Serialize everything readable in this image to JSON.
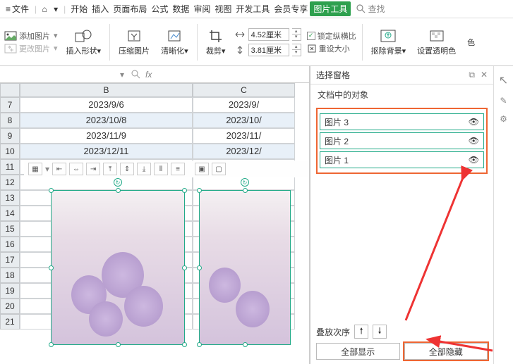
{
  "topbar": {
    "file_label": "文件",
    "search_label": "查找",
    "tabs": [
      "开始",
      "插入",
      "页面布局",
      "公式",
      "数据",
      "审阅",
      "视图",
      "开发工具",
      "会员专享",
      "图片工具"
    ]
  },
  "ribbon": {
    "add_image": "添加图片",
    "change_image": "更改图片",
    "insert_shape": "插入形状",
    "compress": "压缩图片",
    "sharpen": "清晰化",
    "crop": "裁剪",
    "width_val": "4.52厘米",
    "height_val": "3.81厘米",
    "lock_ratio": "锁定纵横比",
    "reset_size": "重设大小",
    "remove_bg": "抠除背景",
    "transparent": "设置透明色",
    "color_short": "色"
  },
  "formula_bar": {
    "fx": "fx"
  },
  "sheet": {
    "cols": [
      "B",
      "C"
    ],
    "rows": [
      {
        "n": 7,
        "b": "2023/9/6",
        "c": "2023/9/"
      },
      {
        "n": 8,
        "b": "2023/10/8",
        "c": "2023/10/"
      },
      {
        "n": 9,
        "b": "2023/11/9",
        "c": "2023/11/"
      },
      {
        "n": 10,
        "b": "2023/12/11",
        "c": "2023/12/"
      },
      {
        "n": 11,
        "b": "",
        "c": ""
      },
      {
        "n": 12,
        "b": "",
        "c": ""
      },
      {
        "n": 13,
        "b": "",
        "c": ""
      },
      {
        "n": 14,
        "b": "",
        "c": ""
      },
      {
        "n": 15,
        "b": "",
        "c": ""
      },
      {
        "n": 16,
        "b": "",
        "c": ""
      },
      {
        "n": 17,
        "b": "",
        "c": ""
      },
      {
        "n": 18,
        "b": "",
        "c": ""
      },
      {
        "n": 19,
        "b": "",
        "c": ""
      },
      {
        "n": 20,
        "b": "",
        "c": ""
      },
      {
        "n": 21,
        "b": "",
        "c": ""
      }
    ]
  },
  "selection_pane": {
    "title": "选择窗格",
    "subtitle": "文档中的对象",
    "items": [
      "图片 3",
      "图片 2",
      "图片 1"
    ],
    "stack_label": "叠放次序",
    "show_all": "全部显示",
    "hide_all": "全部隐藏"
  }
}
